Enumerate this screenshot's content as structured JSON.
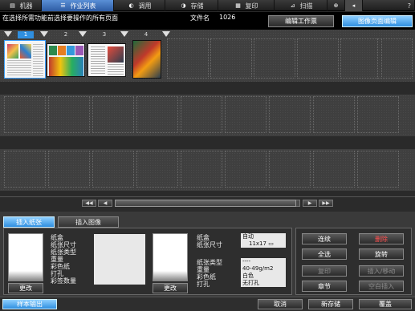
{
  "topbar": {
    "tabs": [
      {
        "label": "机器",
        "icon": "machine-icon"
      },
      {
        "label": "作业列表",
        "icon": "job-list-icon"
      },
      {
        "label": "调用",
        "icon": "recall-icon"
      },
      {
        "label": "存储",
        "icon": "store-icon"
      },
      {
        "label": "复印",
        "icon": "copy-icon"
      },
      {
        "label": "扫描",
        "icon": "scan-icon"
      }
    ],
    "active_tab": "作业列表",
    "globe_icon": "globe-icon",
    "mute_icon": "sound-icon",
    "help_label": "?"
  },
  "header": {
    "instruction": "在选择所需功能前选择要操作的所有页面",
    "file_name_label": "文件名",
    "file_name_value": "1026",
    "edit_job_button": "编辑工作票",
    "image_page_edit_button": "图像页面编辑"
  },
  "pages": {
    "numbers": [
      "1",
      "2",
      "3",
      "4"
    ],
    "selected": "1"
  },
  "scrollbar": {
    "first": "◀◀",
    "prev": "◀",
    "next": "▶",
    "last": "▶▶"
  },
  "bottom_tabs": {
    "insert_paper": "插入纸张",
    "insert_image": "插入图像"
  },
  "left_props": {
    "labels": [
      "纸盒",
      "纸张尺寸",
      "纸张类型",
      "重量",
      "彩色纸",
      "打孔",
      "彩签数量"
    ],
    "change_button": "更改"
  },
  "right_props": {
    "labels": [
      "纸盒",
      "纸张尺寸",
      "纸张类型",
      "重量",
      "彩色纸",
      "打孔"
    ],
    "values": [
      "自动",
      "11x17",
      "----",
      "40-49g/m2",
      "白色",
      "无打孔"
    ],
    "change_button": "更改"
  },
  "actions": {
    "continuous": "连续",
    "delete": "删除",
    "select_all": "全选",
    "rotate": "旋转",
    "copy": "复印",
    "insert_move": "插入/移动",
    "chapter": "章节",
    "blank_insert": "空白插入"
  },
  "footer": {
    "sample_output": "样本输出",
    "cancel": "取消",
    "save_new": "新存储",
    "overwrite": "覆盖"
  }
}
